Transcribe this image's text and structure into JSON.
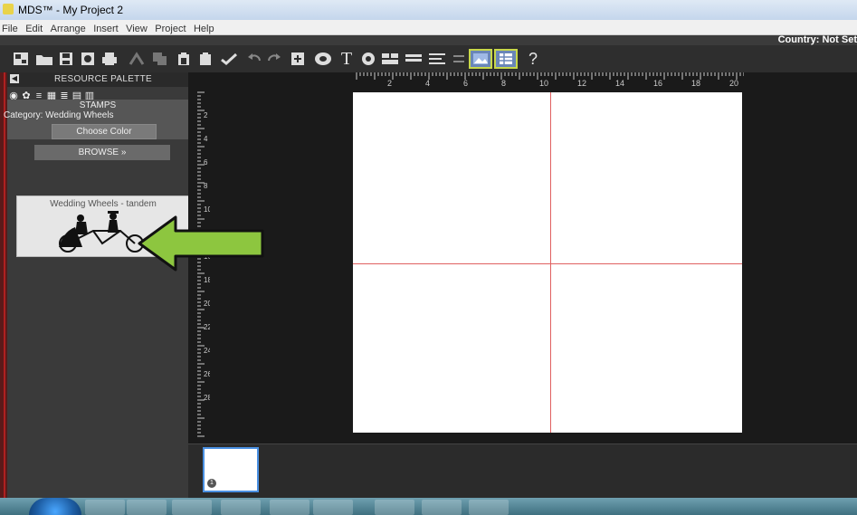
{
  "window": {
    "title": "MDS™ - My Project 2"
  },
  "menu": [
    "File",
    "Edit",
    "Arrange",
    "Insert",
    "View",
    "Project",
    "Help"
  ],
  "country_label": "Country: Not Set",
  "toolbar": {
    "icons": [
      "layout-icon",
      "open-folder-icon",
      "save-icon",
      "preview-icon",
      "print-icon",
      "cut-icon",
      "copy-icon",
      "paste-icon",
      "paste-special-icon",
      "checkmark-icon",
      "undo-icon",
      "redo-icon",
      "add-frame-icon",
      "shape-icon",
      "text-icon",
      "stamp-icon",
      "effects-icon",
      "lines-icon",
      "align-icon",
      "spacing-icon",
      "photo-icon",
      "grid-icon",
      "help-icon"
    ],
    "help_label": "?"
  },
  "palette": {
    "header": "RESOURCE PALETTE",
    "section": "STAMPS",
    "category": "Category: Wedding Wheels",
    "choose_color": "Choose Color",
    "browse": "BROWSE  »"
  },
  "stamp": {
    "caption": "Wedding Wheels - tandem"
  },
  "rulers": {
    "h_labels": [
      "2",
      "4",
      "6",
      "8",
      "10",
      "12",
      "14",
      "16",
      "18",
      "20"
    ],
    "v_labels": [
      "2",
      "4",
      "6",
      "8",
      "10",
      "12",
      "16",
      "18",
      "20",
      "22",
      "24",
      "26",
      "28"
    ]
  },
  "thumbnails": [
    {
      "number": "1"
    }
  ],
  "colors": {
    "accent_arrow": "#8dc63f",
    "guide": "#e06060",
    "selected_thumb": "#4a90e2"
  }
}
